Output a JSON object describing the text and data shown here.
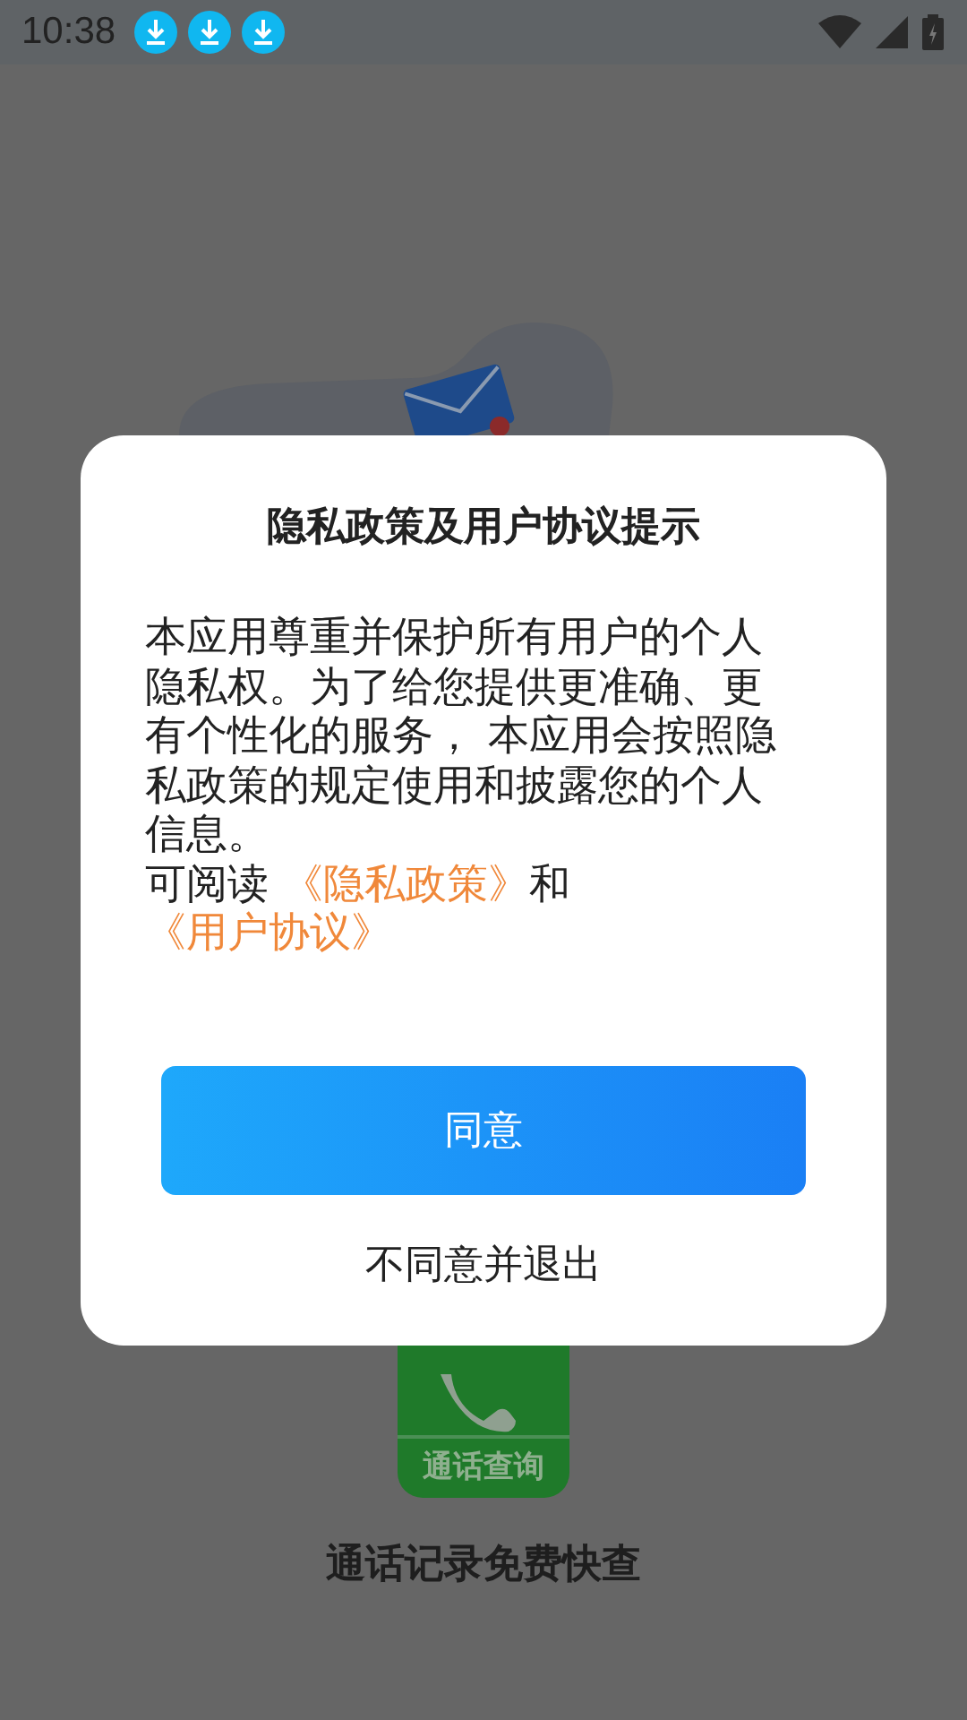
{
  "status_bar": {
    "time": "10:38",
    "notifications": [
      {
        "kind": "download"
      },
      {
        "kind": "download"
      },
      {
        "kind": "download"
      }
    ]
  },
  "app": {
    "icon_label": "通话查询",
    "name": "通话记录免费快查"
  },
  "dialog": {
    "title": "隐私政策及用户协议提示",
    "body": "本应用尊重并保护所有用户的个人隐私权。为了给您提供更准确、更有个性化的服务， 本应用会按照隐私政策的规定使用和披露您的个人信息。",
    "consent": [
      {
        "kind": "text",
        "text": "可阅读 "
      },
      {
        "kind": "link",
        "text": "《隐私政策》"
      },
      {
        "kind": "text",
        "text": "和"
      },
      {
        "kind": "link",
        "text": "《用户协议》"
      }
    ],
    "buttons": [
      {
        "kind": "primary",
        "label": "同意"
      },
      {
        "kind": "plain",
        "label": "不同意并退出"
      }
    ]
  }
}
